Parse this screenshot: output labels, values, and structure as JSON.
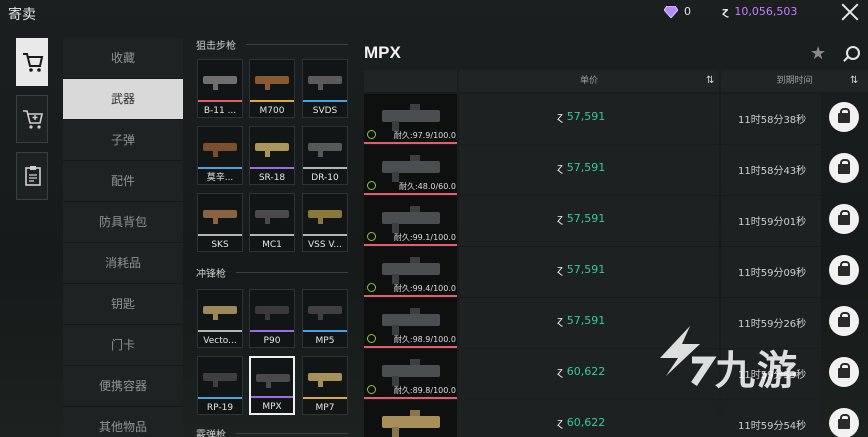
{
  "header": {
    "title": "寄卖",
    "gem_count": "0",
    "money": "10,056,503"
  },
  "left_tabs": [
    {
      "icon": "cart-icon",
      "active": true
    },
    {
      "icon": "cart-add-icon",
      "active": false
    },
    {
      "icon": "clipboard-icon",
      "active": false
    }
  ],
  "categories": [
    {
      "label": "收藏",
      "active": false
    },
    {
      "label": "武器",
      "active": true
    },
    {
      "label": "子弹",
      "active": false
    },
    {
      "label": "配件",
      "active": false
    },
    {
      "label": "防具背包",
      "active": false
    },
    {
      "label": "消耗品",
      "active": false
    },
    {
      "label": "钥匙",
      "active": false
    },
    {
      "label": "门卡",
      "active": false
    },
    {
      "label": "便携容器",
      "active": false
    },
    {
      "label": "其他物品",
      "active": false
    }
  ],
  "weapon_sections": [
    {
      "title": "狙击步枪"
    },
    {
      "title": "冲锋枪"
    },
    {
      "title": "霰弹枪"
    }
  ],
  "weapons": [
    {
      "name": "B-11 ...",
      "bar": "#e35d6a",
      "color": "#6f6f6f"
    },
    {
      "name": "M700",
      "bar": "#e0a64a",
      "color": "#8a5a32"
    },
    {
      "name": "SVDS",
      "bar": "#4aa3e0",
      "color": "#5a5a5a"
    },
    {
      "name": "莫辛...",
      "bar": "#4aa3e0",
      "color": "#7a4e2e"
    },
    {
      "name": "SR-18",
      "bar": "#9b6ee0",
      "color": "#a8965a"
    },
    {
      "name": "DR-10",
      "bar": "#b5b5b5",
      "color": "#555a58"
    },
    {
      "name": "SKS",
      "bar": "#b5b5b5",
      "color": "#8a6442"
    },
    {
      "name": "MC1",
      "bar": "#b5b5b5",
      "color": "#4a4a4a"
    },
    {
      "name": "VSS V...",
      "bar": "#b5b5b5",
      "color": "#8a7a3a"
    },
    {
      "name": "Vecto...",
      "bar": "#b5b5b5",
      "color": "#9a8a5a"
    },
    {
      "name": "P90",
      "bar": "#9b6ee0",
      "color": "#3a3a3a"
    },
    {
      "name": "MP5",
      "bar": "#4aa3e0",
      "color": "#3f3f3f"
    },
    {
      "name": "RP-19",
      "bar": "#4aa3e0",
      "color": "#3f3f3f"
    },
    {
      "name": "MPX",
      "bar": "#9b6ee0",
      "color": "#4a4a4a",
      "selected": true
    },
    {
      "name": "MP7",
      "bar": "#e0a64a",
      "color": "#a8905a"
    }
  ],
  "listing": {
    "title": "MPX",
    "col_price": "单价",
    "col_time": "到期时间",
    "rows": [
      {
        "durability": "耐久:97.9/100.0",
        "price": "57,591",
        "time": "11时58分38秒",
        "gold": false
      },
      {
        "durability": "耐久:48.0/60.0",
        "price": "57,591",
        "time": "11时58分43秒",
        "gold": false
      },
      {
        "durability": "耐久:99.1/100.0",
        "price": "57,591",
        "time": "11时59分01秒",
        "gold": false
      },
      {
        "durability": "耐久:99.4/100.0",
        "price": "57,591",
        "time": "11时59分09秒",
        "gold": false
      },
      {
        "durability": "耐久:98.9/100.0",
        "price": "57,591",
        "time": "11时59分26秒",
        "gold": false
      },
      {
        "durability": "耐久:89.8/100.0",
        "price": "60,622",
        "time": "11时59分53秒",
        "gold": false
      },
      {
        "durability": "",
        "price": "60,622",
        "time": "11时59分54秒",
        "gold": true
      }
    ]
  },
  "watermark": {
    "text": "九游"
  },
  "colors": {
    "price_green": "#36c9a0",
    "money_purple": "#c77dff",
    "durability_red": "#e35d6a"
  }
}
